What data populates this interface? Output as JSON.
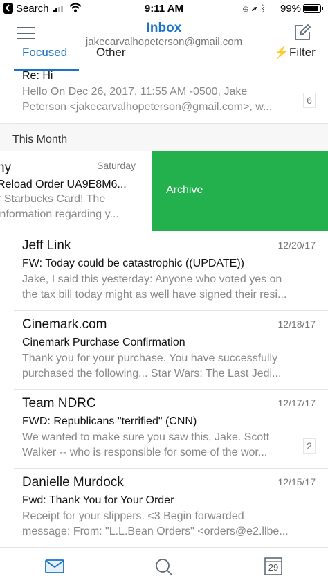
{
  "status_bar": {
    "back_label": "Search",
    "time": "9:11 AM",
    "battery": "99%",
    "icons": [
      "back-chip-icon",
      "signal-icon",
      "wifi-icon",
      "rotation-lock-icon",
      "location-icon",
      "bluetooth-icon",
      "battery-icon"
    ]
  },
  "header": {
    "title": "Inbox",
    "account": "jakecarvalhopeterson@gmail.com",
    "menu_icon": "hamburger-icon",
    "compose_icon": "compose-icon"
  },
  "tabs": {
    "focused": "Focused",
    "other": "Other",
    "filter": "Filter",
    "active": "Focused"
  },
  "top_message": {
    "subject": "Re: Hi",
    "preview_line1": "Hello On Dec 26, 2017, 11:55 AM -0500, Jake",
    "preview_line2": "Peterson <jakecarvalhopeterson@gmail.com>, w...",
    "count": "6"
  },
  "section": {
    "title": "This Month"
  },
  "swiped_message": {
    "sender_fragment": "ny",
    "date": "Saturday",
    "subject_fragment": "Reload Order UA9E8M6...",
    "preview_line1": "r Starbucks Card! The",
    "preview_line2": "information regarding y...",
    "action_label": "Archive",
    "action_color": "#22b14c"
  },
  "messages": [
    {
      "sender": "Jeff Link",
      "date": "12/20/17",
      "subject": "FW: Today could be catastrophic ((UPDATE))",
      "preview_line1": "Jake, I said this yesterday: Anyone who voted yes on",
      "preview_line2": "the tax bill today might as well have signed their resi...",
      "count": ""
    },
    {
      "sender": "Cinemark.com",
      "date": "12/18/17",
      "subject": "Cinemark Purchase Confirmation",
      "preview_line1": "Thank you for your purchase. You have successfully",
      "preview_line2": "purchased the following... Star Wars: The Last Jedi...",
      "count": ""
    },
    {
      "sender": "Team NDRC",
      "date": "12/17/17",
      "subject": "FWD: Republicans \"terrified\" (CNN)",
      "preview_line1": "We wanted to make sure you saw this, Jake. Scott",
      "preview_line2": "Walker -- who is responsible for some of the wor...",
      "count": "2"
    },
    {
      "sender": "Danielle Murdock",
      "date": "12/15/17",
      "subject": "Fwd: Thank You for Your Order",
      "preview_line1": "Receipt for your slippers. <3 Begin forwarded",
      "preview_line2": "message: From: \"L.L.Bean Orders\" <orders@e2.llbe...",
      "count": ""
    }
  ],
  "tabbar": {
    "mail_icon": "mail-icon",
    "search_icon": "search-icon",
    "calendar_icon": "calendar-icon",
    "calendar_day": "29"
  },
  "colors": {
    "accent": "#1a73c8",
    "archive": "#22b14c"
  }
}
